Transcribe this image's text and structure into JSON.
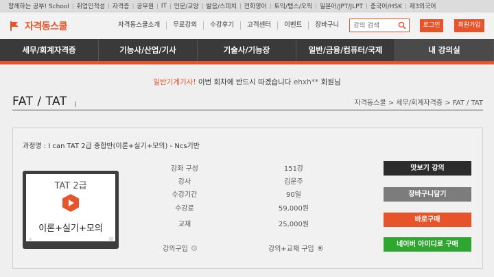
{
  "topbar": {
    "items": [
      "함께하는 공부! ",
      "취업인적성",
      "자격증",
      "공무원",
      "IT",
      "인문/교양",
      "발음/스피치",
      "전화영어",
      "토익/텝스/오픽",
      "일본어/JPT/JLPT",
      "중국어/HSK",
      "제3외국어"
    ],
    "school": "School"
  },
  "header": {
    "logo": "자격동스쿨",
    "gnb": [
      "자격동스쿨소개",
      "무료강의",
      "수강후기",
      "고객센터",
      "이벤트",
      "장바구니"
    ],
    "search_placeholder": "강의 검색",
    "login": "로그인",
    "join": "회원가입"
  },
  "mainnav": [
    "세무/회계자격증",
    "기능사/산업/기사",
    "기술사/기능장",
    "일반/금융/컴퓨터/국제",
    "내 강의실"
  ],
  "banner": {
    "accent": "일반기계기사!",
    "text": " 이번 회차에 반드시 따겠습니다 ",
    "user": "ehxh**",
    "suffix": " 회원님"
  },
  "page": {
    "title": "FAT / TAT",
    "breadcrumb": "자격동스쿨 > 세무/회계자격증 > FAT / TAT"
  },
  "course": {
    "name": "과정명 : I can TAT 2급 종합반(이론+실기+모의) - Ncs기반",
    "thumb_title": "TAT 2급",
    "thumb_sub": "이론+실기+모의",
    "info": [
      {
        "label": "강좌 구성",
        "value": "151강"
      },
      {
        "label": "강사",
        "value": "김운주"
      },
      {
        "label": "수강기간",
        "value": "90일"
      },
      {
        "label": "수강료",
        "value": "59,000원"
      },
      {
        "label": "교재",
        "value": "25,000원"
      }
    ],
    "option_lecture": "강의구입",
    "option_bundle": "강의+교재 구입",
    "buttons": {
      "preview": "맛보기 강의",
      "cart": "장바구니담기",
      "buy": "바로구매",
      "naver": "네이버 아이디로 구매"
    }
  },
  "colors": {
    "accent": "#e8542a",
    "nav": "#3a3a3a",
    "naver": "#2fa62f"
  }
}
